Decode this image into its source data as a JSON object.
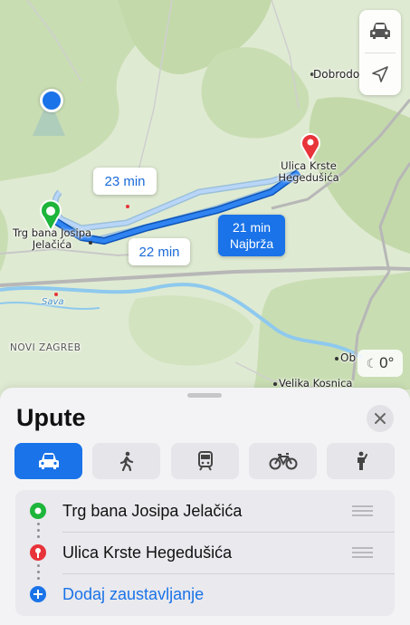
{
  "map": {
    "route_times": {
      "main": "21 min",
      "main_note": "Najbrža",
      "alt1": "23 min",
      "alt2": "22 min"
    },
    "start_label": "Trg bana Josipa Jelačića",
    "end_label": "Ulica Krste Hegedušića",
    "places": {
      "dobrodol": "Dobrodo",
      "sava": "Sava",
      "novi_zagreb": "NOVI ZAGREB",
      "velika_kosnica": "Velika Kosnica",
      "ob": "Ob"
    },
    "weather": "0°",
    "colors": {
      "route": "#1a73e8",
      "alt_route": "#9cc3f5",
      "start_pin": "#1db53a",
      "end_pin": "#e8333a",
      "water": "#8ec9ee"
    }
  },
  "sheet": {
    "title": "Upute",
    "modes": [
      "car-icon",
      "walk-icon",
      "transit-icon",
      "bike-icon",
      "person-icon"
    ],
    "stops": [
      {
        "label": "Trg bana Josipa Jelačića",
        "icon": "start-dot-icon"
      },
      {
        "label": "Ulica Krste Hegedušića",
        "icon": "end-pin-icon"
      }
    ],
    "add_stop": "Dodaj zaustavljanje"
  }
}
